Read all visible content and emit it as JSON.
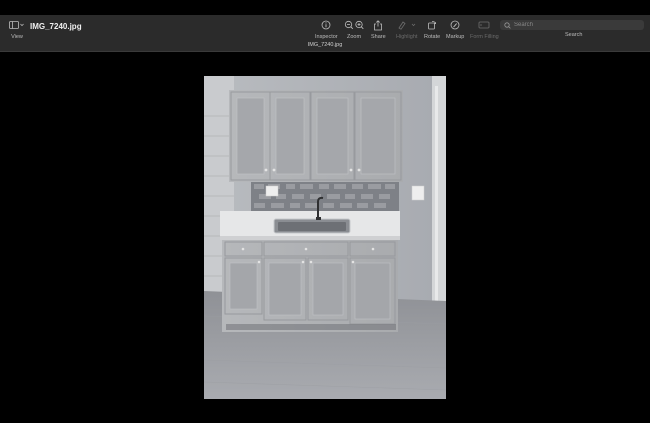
{
  "window": {
    "title": "IMG_7240.jpg",
    "file_tab": "IMG_7240.jpg"
  },
  "toolbar": {
    "view_label": "View",
    "inspector_label": "Inspector",
    "zoom_label": "Zoom",
    "share_label": "Share",
    "highlight_label": "Highlight",
    "rotate_label": "Rotate",
    "markup_label": "Markup",
    "form_filling_label": "Form Filling",
    "search_label": "Search"
  },
  "search": {
    "placeholder": "Search"
  },
  "colors": {
    "toolbar_bg": "#2b2b2b",
    "canvas_bg": "#000000"
  }
}
